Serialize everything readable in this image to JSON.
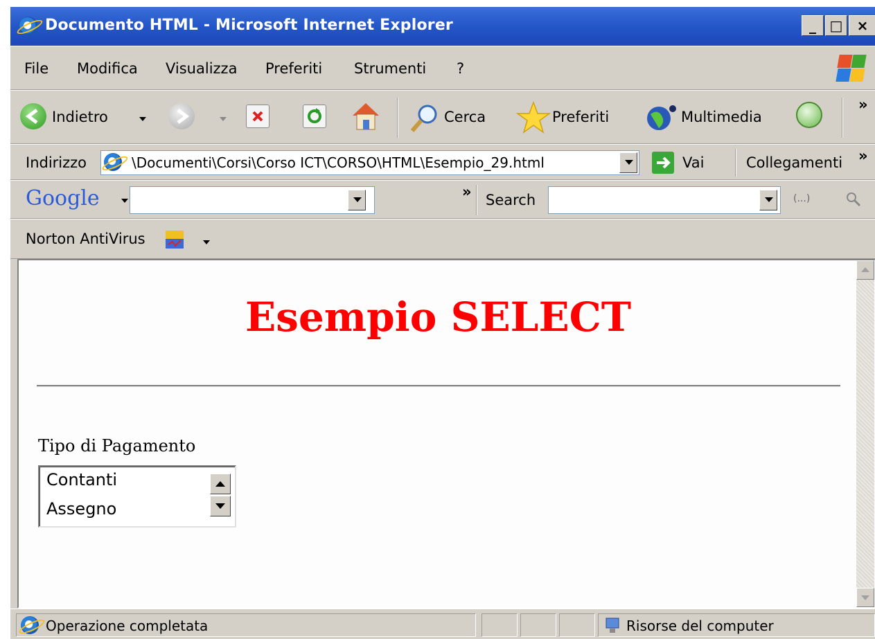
{
  "window": {
    "title": "Documento HTML - Microsoft Internet Explorer",
    "min_label": "_",
    "max_label": "□",
    "close_label": "×"
  },
  "menu": [
    "File",
    "Modifica",
    "Visualizza",
    "Preferiti",
    "Strumenti",
    "?"
  ],
  "toolbar": {
    "back_label": "Indietro",
    "search_label": "Cerca",
    "favorites_label": "Preferiti",
    "media_label": "Multimedia",
    "overflow": "»"
  },
  "address": {
    "label": "Indirizzo",
    "value": "\\Documenti\\Corsi\\Corso ICT\\CORSO\\HTML\\Esempio_29.html",
    "go_label": "Vai",
    "links_label": "Collegamenti",
    "overflow": "»"
  },
  "google": {
    "logo": "Google",
    "search_label": "Search",
    "overflow": "»",
    "extra": "(...)"
  },
  "norton": {
    "label": "Norton AntiVirus"
  },
  "page": {
    "heading": "Esempio SELECT",
    "field_label": "Tipo di Pagamento",
    "options": [
      "Contanti",
      "Assegno"
    ]
  },
  "status": {
    "text": "Operazione completata",
    "zone": "Risorse del computer"
  },
  "colors": {
    "title_bar": "#2456c8",
    "heading": "#ff0000",
    "chrome": "#d4d0c8"
  }
}
